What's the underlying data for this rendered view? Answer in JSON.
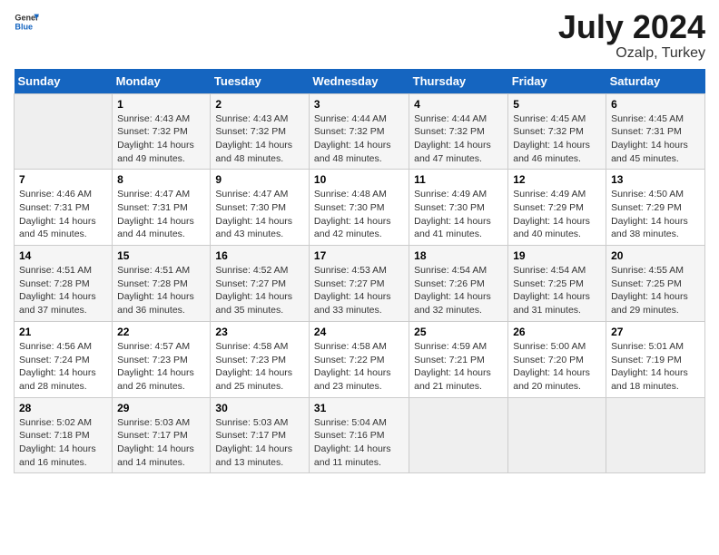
{
  "header": {
    "logo_general": "General",
    "logo_blue": "Blue",
    "month_title": "July 2024",
    "location": "Ozalp, Turkey"
  },
  "weekdays": [
    "Sunday",
    "Monday",
    "Tuesday",
    "Wednesday",
    "Thursday",
    "Friday",
    "Saturday"
  ],
  "weeks": [
    [
      {
        "day": "",
        "info": ""
      },
      {
        "day": "1",
        "info": "Sunrise: 4:43 AM\nSunset: 7:32 PM\nDaylight: 14 hours\nand 49 minutes."
      },
      {
        "day": "2",
        "info": "Sunrise: 4:43 AM\nSunset: 7:32 PM\nDaylight: 14 hours\nand 48 minutes."
      },
      {
        "day": "3",
        "info": "Sunrise: 4:44 AM\nSunset: 7:32 PM\nDaylight: 14 hours\nand 48 minutes."
      },
      {
        "day": "4",
        "info": "Sunrise: 4:44 AM\nSunset: 7:32 PM\nDaylight: 14 hours\nand 47 minutes."
      },
      {
        "day": "5",
        "info": "Sunrise: 4:45 AM\nSunset: 7:32 PM\nDaylight: 14 hours\nand 46 minutes."
      },
      {
        "day": "6",
        "info": "Sunrise: 4:45 AM\nSunset: 7:31 PM\nDaylight: 14 hours\nand 45 minutes."
      }
    ],
    [
      {
        "day": "7",
        "info": "Sunrise: 4:46 AM\nSunset: 7:31 PM\nDaylight: 14 hours\nand 45 minutes."
      },
      {
        "day": "8",
        "info": "Sunrise: 4:47 AM\nSunset: 7:31 PM\nDaylight: 14 hours\nand 44 minutes."
      },
      {
        "day": "9",
        "info": "Sunrise: 4:47 AM\nSunset: 7:30 PM\nDaylight: 14 hours\nand 43 minutes."
      },
      {
        "day": "10",
        "info": "Sunrise: 4:48 AM\nSunset: 7:30 PM\nDaylight: 14 hours\nand 42 minutes."
      },
      {
        "day": "11",
        "info": "Sunrise: 4:49 AM\nSunset: 7:30 PM\nDaylight: 14 hours\nand 41 minutes."
      },
      {
        "day": "12",
        "info": "Sunrise: 4:49 AM\nSunset: 7:29 PM\nDaylight: 14 hours\nand 40 minutes."
      },
      {
        "day": "13",
        "info": "Sunrise: 4:50 AM\nSunset: 7:29 PM\nDaylight: 14 hours\nand 38 minutes."
      }
    ],
    [
      {
        "day": "14",
        "info": "Sunrise: 4:51 AM\nSunset: 7:28 PM\nDaylight: 14 hours\nand 37 minutes."
      },
      {
        "day": "15",
        "info": "Sunrise: 4:51 AM\nSunset: 7:28 PM\nDaylight: 14 hours\nand 36 minutes."
      },
      {
        "day": "16",
        "info": "Sunrise: 4:52 AM\nSunset: 7:27 PM\nDaylight: 14 hours\nand 35 minutes."
      },
      {
        "day": "17",
        "info": "Sunrise: 4:53 AM\nSunset: 7:27 PM\nDaylight: 14 hours\nand 33 minutes."
      },
      {
        "day": "18",
        "info": "Sunrise: 4:54 AM\nSunset: 7:26 PM\nDaylight: 14 hours\nand 32 minutes."
      },
      {
        "day": "19",
        "info": "Sunrise: 4:54 AM\nSunset: 7:25 PM\nDaylight: 14 hours\nand 31 minutes."
      },
      {
        "day": "20",
        "info": "Sunrise: 4:55 AM\nSunset: 7:25 PM\nDaylight: 14 hours\nand 29 minutes."
      }
    ],
    [
      {
        "day": "21",
        "info": "Sunrise: 4:56 AM\nSunset: 7:24 PM\nDaylight: 14 hours\nand 28 minutes."
      },
      {
        "day": "22",
        "info": "Sunrise: 4:57 AM\nSunset: 7:23 PM\nDaylight: 14 hours\nand 26 minutes."
      },
      {
        "day": "23",
        "info": "Sunrise: 4:58 AM\nSunset: 7:23 PM\nDaylight: 14 hours\nand 25 minutes."
      },
      {
        "day": "24",
        "info": "Sunrise: 4:58 AM\nSunset: 7:22 PM\nDaylight: 14 hours\nand 23 minutes."
      },
      {
        "day": "25",
        "info": "Sunrise: 4:59 AM\nSunset: 7:21 PM\nDaylight: 14 hours\nand 21 minutes."
      },
      {
        "day": "26",
        "info": "Sunrise: 5:00 AM\nSunset: 7:20 PM\nDaylight: 14 hours\nand 20 minutes."
      },
      {
        "day": "27",
        "info": "Sunrise: 5:01 AM\nSunset: 7:19 PM\nDaylight: 14 hours\nand 18 minutes."
      }
    ],
    [
      {
        "day": "28",
        "info": "Sunrise: 5:02 AM\nSunset: 7:18 PM\nDaylight: 14 hours\nand 16 minutes."
      },
      {
        "day": "29",
        "info": "Sunrise: 5:03 AM\nSunset: 7:17 PM\nDaylight: 14 hours\nand 14 minutes."
      },
      {
        "day": "30",
        "info": "Sunrise: 5:03 AM\nSunset: 7:17 PM\nDaylight: 14 hours\nand 13 minutes."
      },
      {
        "day": "31",
        "info": "Sunrise: 5:04 AM\nSunset: 7:16 PM\nDaylight: 14 hours\nand 11 minutes."
      },
      {
        "day": "",
        "info": ""
      },
      {
        "day": "",
        "info": ""
      },
      {
        "day": "",
        "info": ""
      }
    ]
  ]
}
